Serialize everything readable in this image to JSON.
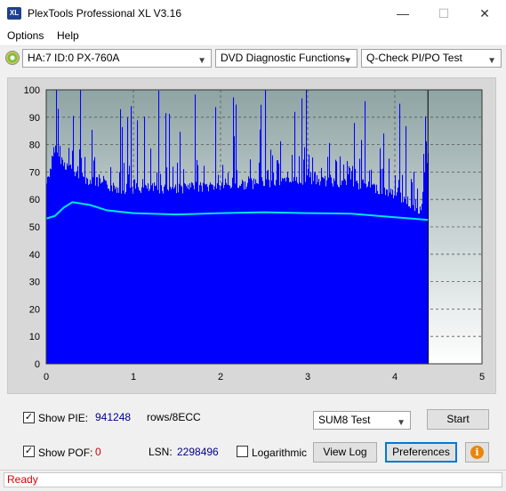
{
  "window": {
    "title": "PlexTools Professional XL V3.16",
    "icon_text": "XL",
    "min": "—",
    "max": "☐",
    "close": "✕"
  },
  "menu": {
    "options": "Options",
    "help": "Help"
  },
  "toolbar": {
    "drive": "HA:7 ID:0  PX-760A",
    "function": "DVD Diagnostic Functions",
    "test": "Q-Check PI/PO Test"
  },
  "chart_data": {
    "type": "bar",
    "xlim": [
      0,
      5
    ],
    "ylim": [
      0,
      100
    ],
    "xticks": [
      "0",
      "1",
      "2",
      "3",
      "4",
      "5"
    ],
    "yticks": [
      "0",
      "10",
      "20",
      "30",
      "40",
      "50",
      "60",
      "70",
      "80",
      "90",
      "100"
    ],
    "data_end_x": 4.38,
    "grid": true,
    "series": [
      {
        "color": "#0000ff",
        "x": [
          0,
          0.1,
          0.2,
          0.4,
          0.6,
          0.8,
          1.0,
          1.5,
          2.0,
          2.5,
          3.0,
          3.5,
          3.8,
          4.0,
          4.2,
          4.3,
          4.35,
          4.38
        ],
        "values": [
          68,
          80,
          75,
          70,
          68,
          66,
          66,
          66,
          67,
          68,
          69,
          68,
          66,
          64,
          60,
          58,
          72,
          80
        ]
      },
      {
        "color": "#00e5e5",
        "x": [
          0,
          0.1,
          0.2,
          0.3,
          0.5,
          0.7,
          1.0,
          1.5,
          2.0,
          2.5,
          3.0,
          3.5,
          4.0,
          4.2,
          4.38
        ],
        "values": [
          53,
          54,
          57,
          59,
          58,
          56,
          55,
          54.5,
          55,
          55.3,
          55,
          54.8,
          53.5,
          53,
          52.5
        ]
      }
    ]
  },
  "bottom": {
    "show_pie_label": "Show PIE:",
    "pie_value": "941248",
    "rows_label": "rows/8ECC",
    "show_pof_label": "Show POF:",
    "pof_value": "0",
    "lsn_label": "LSN:",
    "lsn_value": "2298496",
    "log_label": "Logarithmic",
    "sum_select": "SUM8 Test",
    "start": "Start",
    "view_log": "View Log",
    "preferences": "Preferences",
    "info": "i"
  },
  "status": {
    "text": "Ready"
  },
  "colors": {
    "pie_value": "#00008b",
    "pof_value": "#d00000",
    "status": "#d00000",
    "accent": "#0078d7"
  }
}
